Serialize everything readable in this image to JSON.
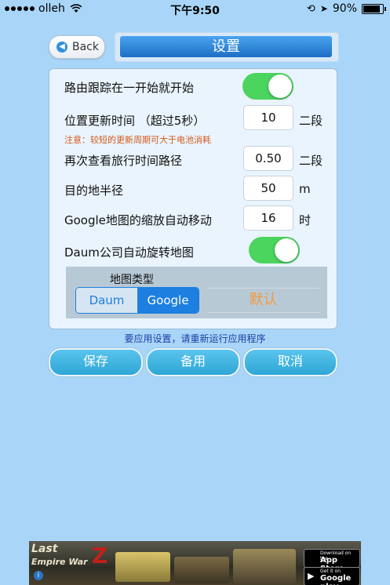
{
  "status_bar": {
    "carrier": "olleh",
    "time": "下午9:50",
    "battery": "90%"
  },
  "header": {
    "back_label": "Back",
    "title": "设置"
  },
  "settings": {
    "route_tracking_label": "路由跟踪在一开始就开始",
    "route_tracking_on": true,
    "location_update_label": "位置更新时间 （超过5秒）",
    "location_update_value": "10",
    "location_update_unit": "二段",
    "note": "注意：较短的更新周期可大于电池消耗",
    "travel_time_label": "再次查看旅行时间路径",
    "travel_time_value": "0.50",
    "travel_time_unit": "二段",
    "radius_label": "目的地半径",
    "radius_value": "50",
    "radius_unit": "m",
    "zoom_label": "Google地图的缩放自动移动",
    "zoom_value": "16",
    "zoom_unit": "时",
    "rotate_label": "Daum公司自动旋转地图",
    "rotate_on": true
  },
  "map_type": {
    "label": "地图类型",
    "options": [
      "Daum",
      "Google"
    ],
    "selected": "Google",
    "default_label": "默认"
  },
  "restart_note": "要应用设置，请重新运行应用程序",
  "buttons": {
    "save": "保存",
    "backup": "备用",
    "cancel": "取消"
  },
  "ad": {
    "title_line1": "Last",
    "title_line2": "Empire War",
    "title_mark": "Z",
    "app_store_small": "Download on the",
    "app_store_big": "App Store",
    "google_play_small": "Get it on",
    "google_play_big": "Google play"
  },
  "colors": {
    "background": "#a9d6f8",
    "toggle_on": "#4bd45e",
    "accent": "#1d7fe0",
    "default_text": "#f39a3d",
    "note_text": "#d35b1a"
  }
}
